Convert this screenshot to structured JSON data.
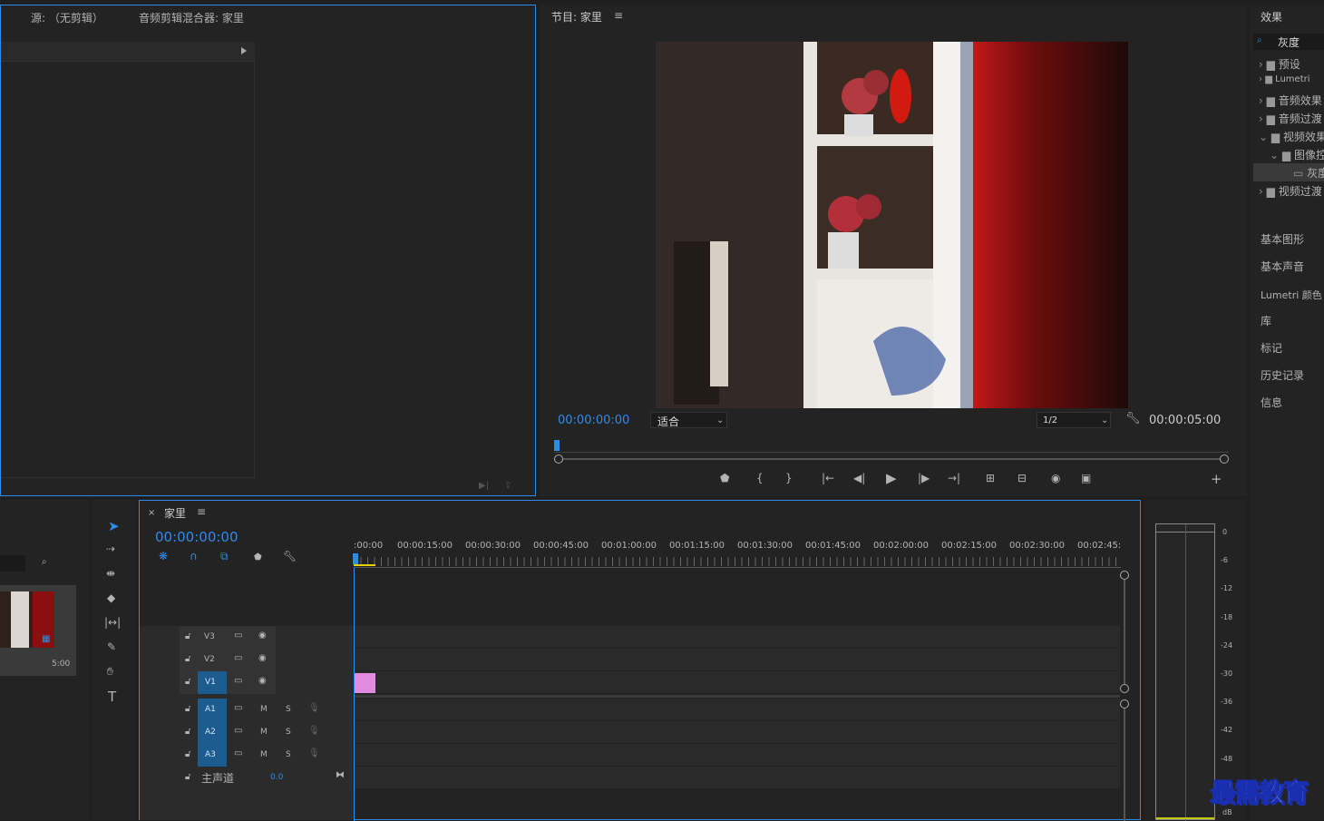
{
  "source_panel": {
    "tab_source": "源: （无剪辑）",
    "tab_mixer": "音频剪辑混合器: 家里"
  },
  "program": {
    "title": "节目: 家里",
    "timecode": "00:00:00:00",
    "fit": "适合",
    "resolution": "1/2",
    "duration": "00:00:05:00"
  },
  "effects": {
    "title": "效果",
    "search_value": "灰度",
    "tree": [
      {
        "label": "预设"
      },
      {
        "label": "Lumetri"
      },
      {
        "label": "音频效果"
      },
      {
        "label": "音频过渡"
      },
      {
        "label": "视频效果"
      },
      {
        "label": "图像控制"
      },
      {
        "label": "灰度"
      },
      {
        "label": "视频过渡"
      }
    ],
    "panels": [
      "基本图形",
      "基本声音",
      "Lumetri 颜色",
      "库",
      "标记",
      "历史记录",
      "信息"
    ]
  },
  "project": {
    "thumb_duration": "5:00"
  },
  "timeline": {
    "title": "家里",
    "timecode": "00:00:00:00",
    "ruler": [
      ":00:00",
      "00:00:15:00",
      "00:00:30:00",
      "00:00:45:00",
      "00:01:00:00",
      "00:01:15:00",
      "00:01:30:00",
      "00:01:45:00",
      "00:02:00:00",
      "00:02:15:00",
      "00:02:30:00",
      "00:02:45:"
    ],
    "video_tracks": [
      "V3",
      "V2",
      "V1"
    ],
    "audio_tracks": [
      "A1",
      "A2",
      "A3"
    ],
    "mute": "M",
    "solo": "S",
    "master_label": "主声道",
    "master_value": "0.0"
  },
  "meter": {
    "ticks": [
      "0",
      "-6",
      "-12",
      "-18",
      "-24",
      "-30",
      "-36",
      "-42",
      "-48"
    ],
    "unit": "dB"
  },
  "watermark": "最需教育",
  "colors": {
    "accent": "#2d8ceb",
    "clip": "#e08ae0",
    "track_active": "#1d5c8f"
  }
}
